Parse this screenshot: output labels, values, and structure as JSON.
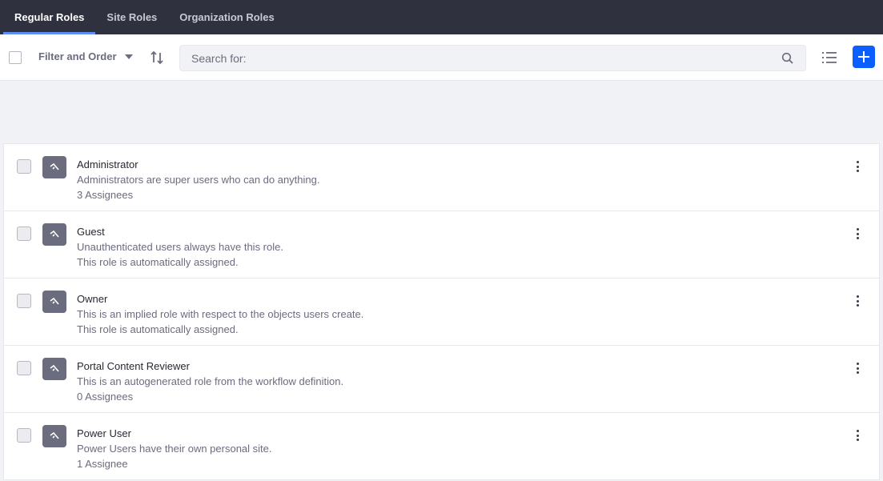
{
  "tabs": [
    {
      "label": "Regular Roles",
      "active": true
    },
    {
      "label": "Site Roles",
      "active": false
    },
    {
      "label": "Organization Roles",
      "active": false
    }
  ],
  "toolbar": {
    "filter_label": "Filter and Order",
    "search_placeholder": "Search for:",
    "sort_icon": "sort-icon",
    "view_icon": "list-view-icon",
    "add_icon": "plus-icon"
  },
  "colors": {
    "nav_bg": "#30313f",
    "accent": "#0b5fff",
    "sticker": "#6b6c7e"
  },
  "roles": [
    {
      "title": "Administrator",
      "description": "Administrators are super users who can do anything.",
      "detail": "3 Assignees"
    },
    {
      "title": "Guest",
      "description": "Unauthenticated users always have this role.",
      "detail": "This role is automatically assigned."
    },
    {
      "title": "Owner",
      "description": "This is an implied role with respect to the objects users create.",
      "detail": "This role is automatically assigned."
    },
    {
      "title": "Portal Content Reviewer",
      "description": "This is an autogenerated role from the workflow definition.",
      "detail": "0 Assignees"
    },
    {
      "title": "Power User",
      "description": "Power Users have their own personal site.",
      "detail": "1 Assignee"
    }
  ]
}
